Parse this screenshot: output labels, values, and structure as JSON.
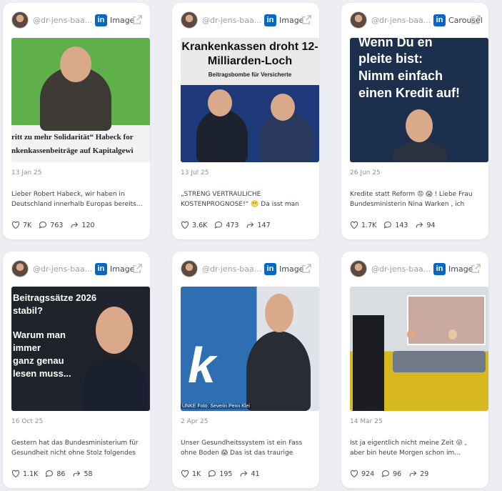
{
  "colors": {
    "linkedin": "#0a66c2",
    "card_bg": "#ffffff",
    "page_bg": "#eceef3"
  },
  "posts": [
    {
      "handle": "@dr-jens-baa...",
      "type": "Image",
      "image_text": {
        "line1": "ritt zu mehr Solidarität“ Habeck for",
        "line2": "nkenkassenbeiträge auf Kapitalgewi"
      },
      "date": "13 Jan 25",
      "text": "Lieber Robert Habeck, wir haben in Deutschland innerhalb Europas bereits…",
      "likes": "7K",
      "comments": "763",
      "shares": "120"
    },
    {
      "handle": "@dr-jens-baa...",
      "type": "Image",
      "image_text": {
        "line1": "Krankenkassen droht 12-",
        "line2": "Milliarden-Loch",
        "line3": "Beitragsbombe für Versicherte"
      },
      "date": "13 Jul 25",
      "text": "„STRENG VERTRAULICHE KOSTENPROGNOSE!“ 😬 Da isst man nicht…",
      "likes": "3.6K",
      "comments": "473",
      "shares": "147"
    },
    {
      "handle": "@dr-jens-baa...",
      "type": "Carousel",
      "image_text": {
        "line1": "Wenn Du en",
        "line2": "pleite bist:",
        "line3": "Nimm einfach",
        "line4": "einen Kredit auf!"
      },
      "date": "26 Jun 25",
      "text": "Kredite statt Reform 😡 😱 ! Liebe Frau Bundesministerin Nina Warken , ich weiß,…",
      "likes": "1.7K",
      "comments": "143",
      "shares": "94"
    },
    {
      "handle": "@dr-jens-baa...",
      "type": "Image",
      "image_text": {
        "line1": "Beitragssätze 2026",
        "line2": "stabil?",
        "line3": "Warum man",
        "line4": "immer",
        "line5": "ganz genau",
        "line6": "lesen muss..."
      },
      "date": "16 Oct 25",
      "text": "Gestern hat das Bundesministerium für Gesundheit nicht ohne Stolz folgendes in…",
      "likes": "1.1K",
      "comments": "86",
      "shares": "58"
    },
    {
      "handle": "@dr-jens-baa...",
      "type": "Image",
      "image_text": {
        "line1": "UNKE Foto: Severin Penn Klei"
      },
      "date": "2 Apr 25",
      "text": "Unser Gesundheitssystem ist ein Fass ohne Boden 😱 Das ist das traurige Fazit…",
      "likes": "1K",
      "comments": "195",
      "shares": "41"
    },
    {
      "handle": "@dr-jens-baa...",
      "type": "Image",
      "image_text": {},
      "date": "14 Mar 25",
      "text": "Ist ja eigentlich nicht meine Zeit 😜 , aber bin heute Morgen schon im…",
      "likes": "924",
      "comments": "96",
      "shares": "29"
    }
  ]
}
